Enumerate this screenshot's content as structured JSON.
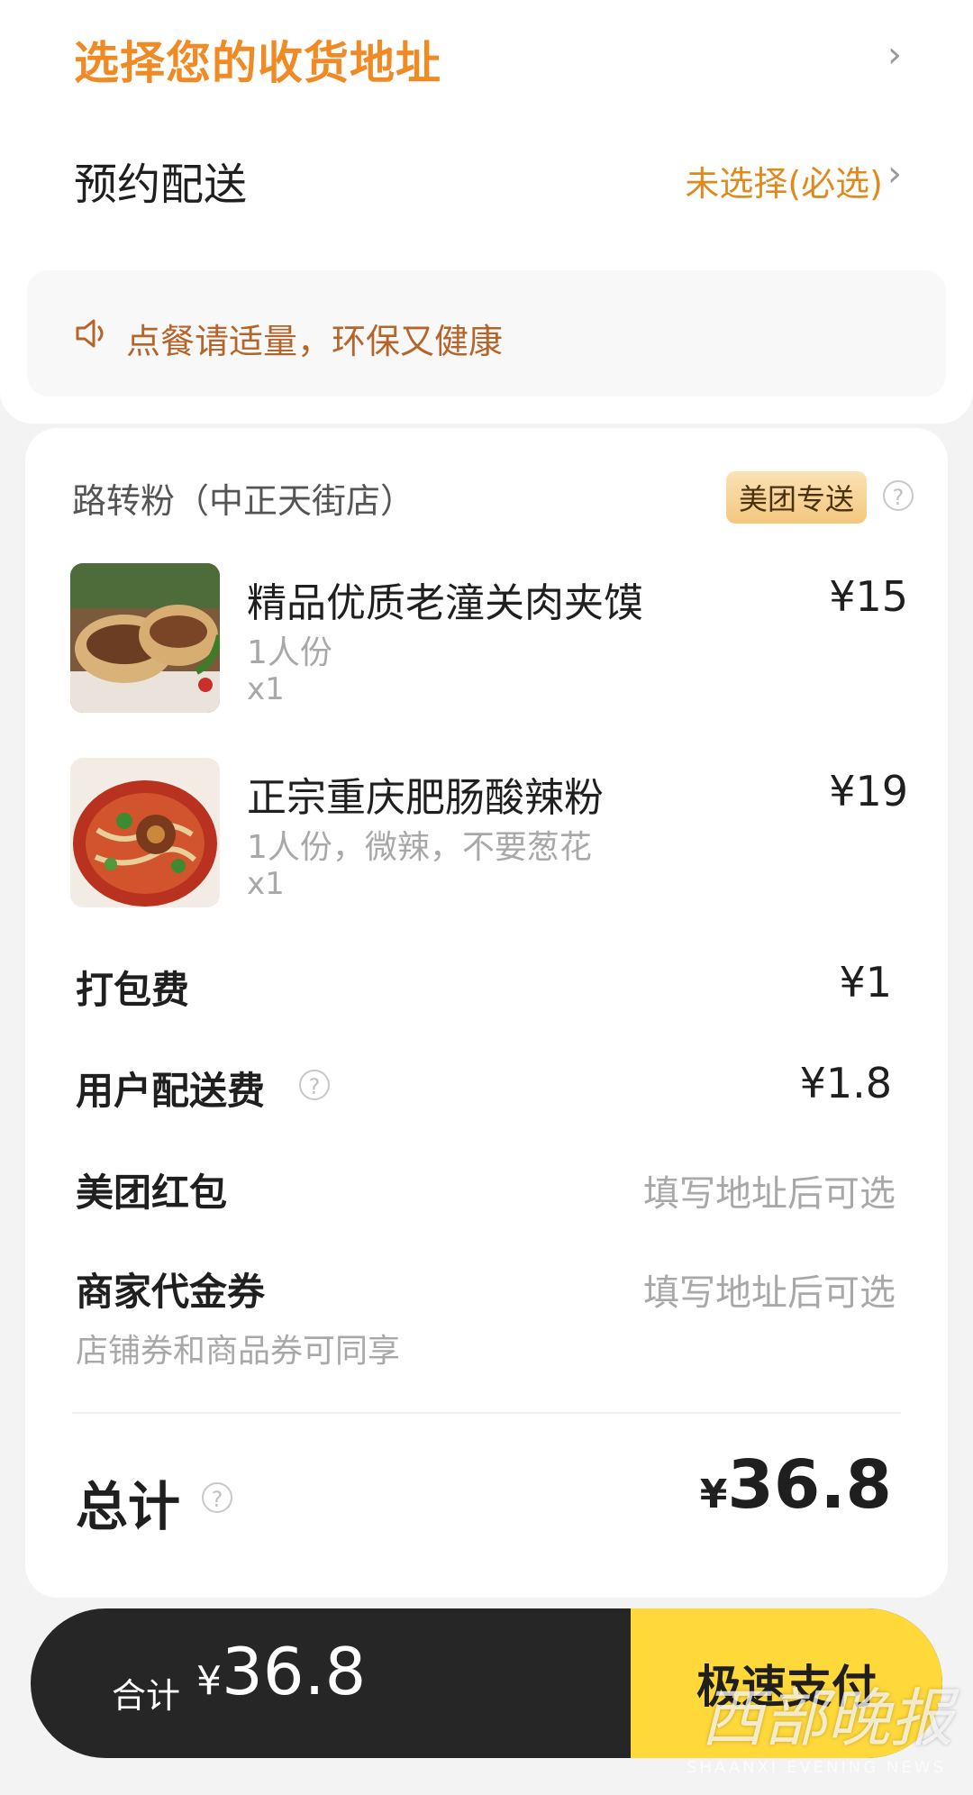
{
  "address": {
    "title": "选择您的收货地址"
  },
  "delivery": {
    "label": "预约配送",
    "status": "未选择(必选)"
  },
  "notice": {
    "text": "点餐请适量，环保又健康"
  },
  "shop": {
    "name": "路转粉（中正天街店）",
    "badge": "美团专送"
  },
  "items": [
    {
      "name": "精品优质老潼关肉夹馍",
      "spec": "1人份",
      "qty": "x1",
      "price": "¥15"
    },
    {
      "name": "正宗重庆肥肠酸辣粉",
      "spec": "1人份，微辣，不要葱花",
      "qty": "x1",
      "price": "¥19"
    }
  ],
  "fees": {
    "packing_label": "打包费",
    "packing_value": "¥1",
    "delivery_label": "用户配送费",
    "delivery_value": "¥1.8",
    "redpacket_label": "美团红包",
    "redpacket_value": "填写地址后可选",
    "voucher_label": "商家代金券",
    "voucher_value": "填写地址后可选",
    "voucher_note": "店铺券和商品券可同享"
  },
  "total": {
    "label": "总计",
    "currency": "¥",
    "amount": "36.8"
  },
  "bottom": {
    "label": "合计",
    "currency": "¥",
    "amount": "36.8",
    "pay_button": "极速支付"
  },
  "watermark": {
    "text": "西部晚报",
    "sub": "SHAANXI EVENING NEWS"
  },
  "colors": {
    "accent": "#f08a24",
    "pay": "#ffd83a",
    "bar": "#262626"
  }
}
